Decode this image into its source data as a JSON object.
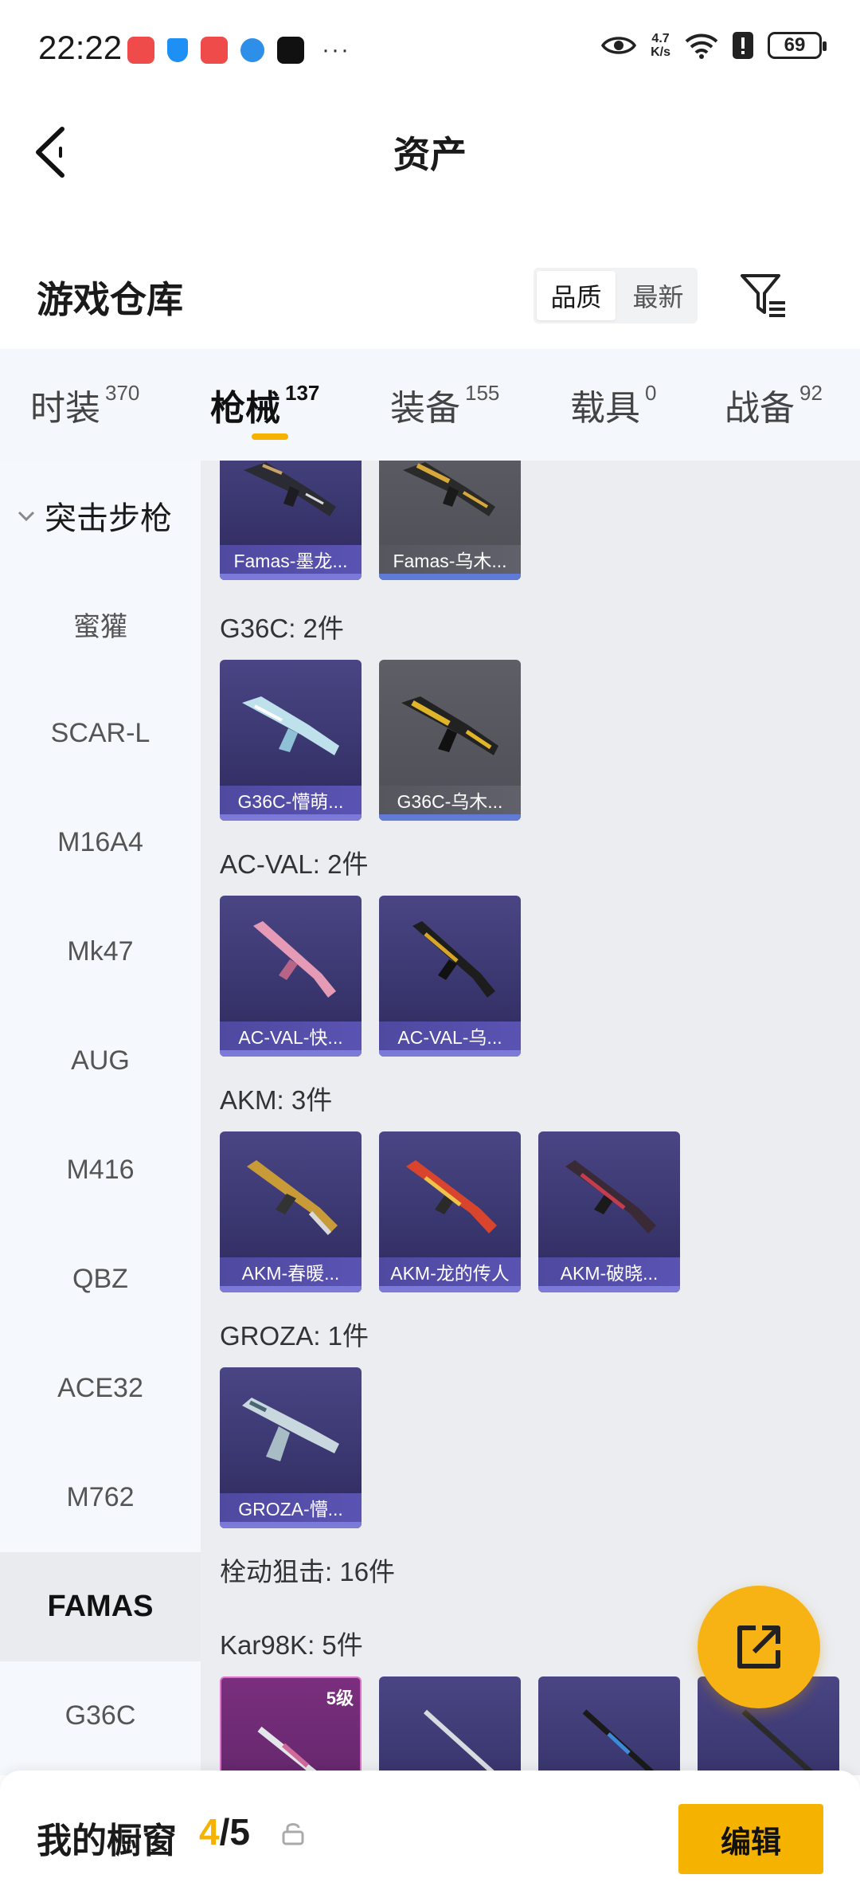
{
  "status_bar": {
    "time": "22:22",
    "network_speed_value": "4.7",
    "network_speed_unit": "K/s",
    "battery": "69"
  },
  "header": {
    "title": "资产"
  },
  "warehouse": {
    "title": "游戏仓库",
    "sort_options": [
      "品质",
      "最新"
    ],
    "selected_sort": "品质"
  },
  "categories": [
    {
      "label": "时装",
      "count": "370"
    },
    {
      "label": "枪械",
      "count": "137"
    },
    {
      "label": "装备",
      "count": "155"
    },
    {
      "label": "载具",
      "count": "0"
    },
    {
      "label": "战备",
      "count": "92"
    }
  ],
  "active_category": "枪械",
  "sidebar": {
    "group": "突击步枪",
    "items": [
      "蜜獾",
      "SCAR-L",
      "M16A4",
      "Mk47",
      "AUG",
      "M416",
      "QBZ",
      "ACE32",
      "M762",
      "FAMAS",
      "G36C"
    ],
    "selected": "FAMAS"
  },
  "groups": [
    {
      "label": "",
      "items": [
        {
          "name": "Famas-墨龙...",
          "rarity": "purple"
        },
        {
          "name": "Famas-乌木...",
          "rarity": "grey"
        }
      ]
    },
    {
      "label": "G36C: 2件",
      "items": [
        {
          "name": "G36C-懵萌...",
          "rarity": "purple"
        },
        {
          "name": "G36C-乌木...",
          "rarity": "grey"
        }
      ]
    },
    {
      "label": "AC-VAL: 2件",
      "items": [
        {
          "name": "AC-VAL-快...",
          "rarity": "purple"
        },
        {
          "name": "AC-VAL-乌...",
          "rarity": "purple"
        }
      ]
    },
    {
      "label": "AKM: 3件",
      "items": [
        {
          "name": "AKM-春暖...",
          "rarity": "purple"
        },
        {
          "name": "AKM-龙的传人",
          "rarity": "purple"
        },
        {
          "name": "AKM-破晓...",
          "rarity": "purple"
        }
      ]
    },
    {
      "label": "GROZA: 1件",
      "items": [
        {
          "name": "GROZA-懵...",
          "rarity": "purple"
        }
      ]
    },
    {
      "label": "栓动狙击: 16件",
      "items": []
    },
    {
      "label": "Kar98K: 5件",
      "items": [
        {
          "name": "",
          "rarity": "pink",
          "level": "5级"
        },
        {
          "name": "",
          "rarity": "purple"
        },
        {
          "name": "",
          "rarity": "purple"
        },
        {
          "name": "",
          "rarity": "purple"
        }
      ]
    }
  ],
  "showcase": {
    "title": "我的橱窗",
    "current": "4",
    "separator": "/",
    "total": "5",
    "edit_label": "编辑"
  },
  "colors": {
    "accent": "#f5b300",
    "purple_rarity": "#4a4584",
    "grey_rarity": "#5e5f66",
    "pink_rarity": "#7a2f7e"
  }
}
